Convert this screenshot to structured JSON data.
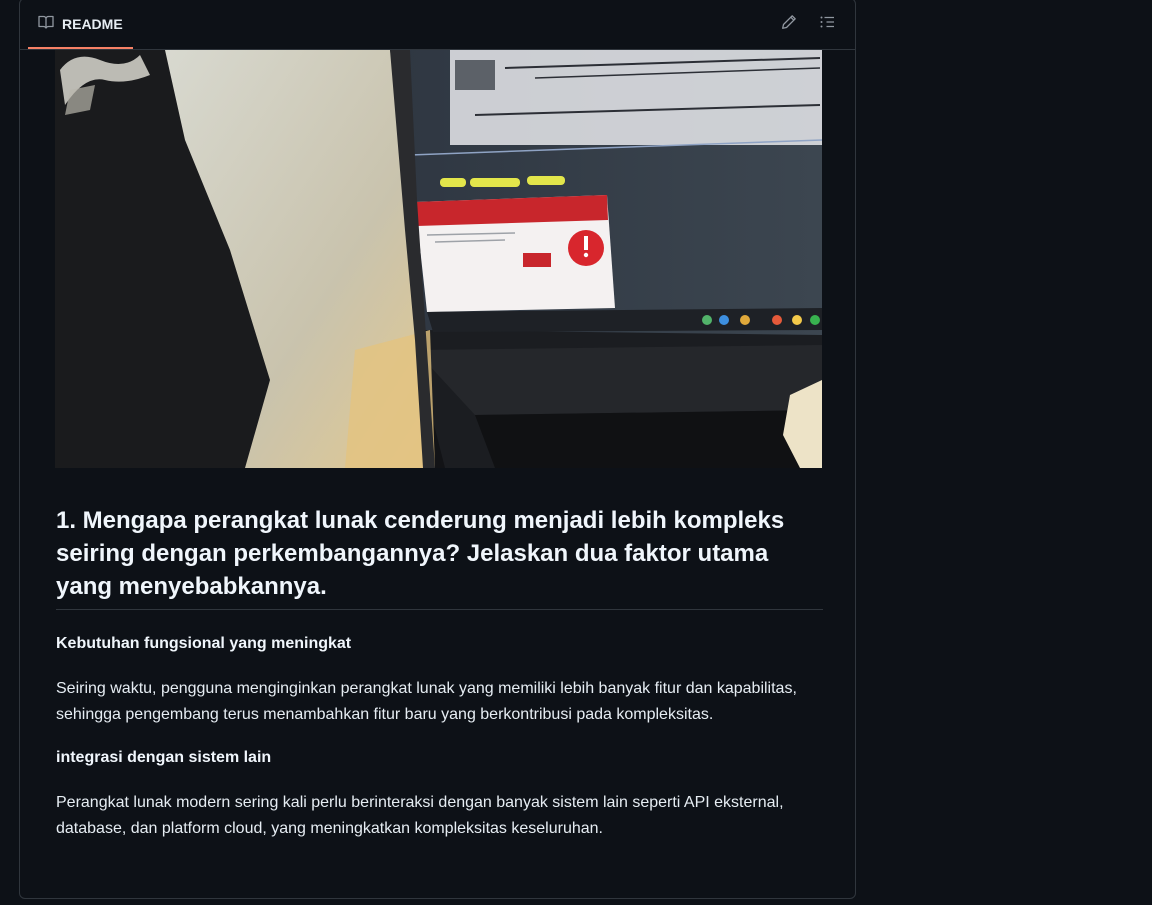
{
  "readme": {
    "tab_label": "README",
    "tab_icon": "book-icon",
    "edit_icon": "pencil-icon",
    "outline_icon": "list-icon"
  },
  "photo": {
    "alt": "Photo of a laptop screen showing a McAfee pop-up",
    "popup_title": "Your McAfee Antivirus Has Expired!",
    "popup_button": "Fix it!",
    "popup_brand": "McAfee"
  },
  "article": {
    "heading": "1. Mengapa perangkat lunak cenderung menjadi lebih kompleks seiring dengan perkembangannya? Jelaskan dua faktor utama yang menyebabkannya.",
    "sections": [
      {
        "title": "Kebutuhan fungsional yang meningkat",
        "body": "Seiring waktu, pengguna menginginkan perangkat lunak yang memiliki lebih banyak fitur dan kapabilitas, sehingga pengembang terus menambahkan fitur baru yang berkontribusi pada kompleksitas."
      },
      {
        "title": "integrasi dengan sistem lain",
        "body": "Perangkat lunak modern sering kali perlu berinteraksi dengan banyak sistem lain seperti API eksternal, database, dan platform cloud, yang meningkatkan kompleksitas keseluruhan."
      }
    ]
  },
  "colors": {
    "background": "#0d1117",
    "border": "#30363d",
    "tab_underline": "#f78166",
    "text": "#e6edf3"
  }
}
